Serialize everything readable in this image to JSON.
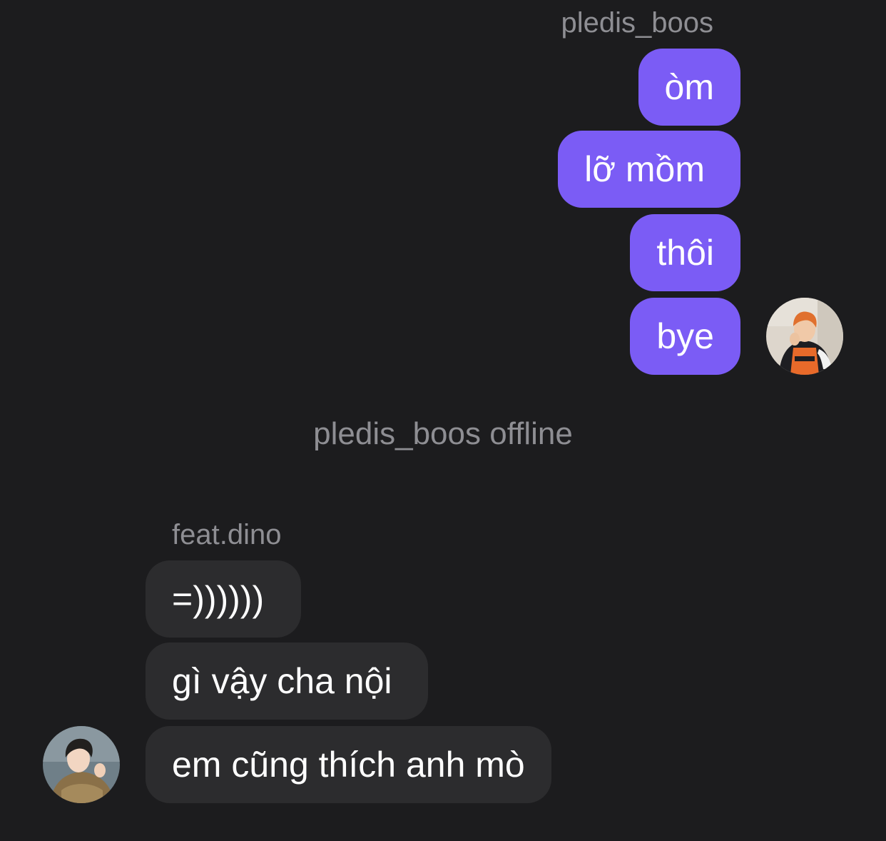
{
  "outgoing": {
    "sender": "pledis_boos",
    "messages": [
      "òm",
      "lỡ mồm",
      "thôi",
      "bye"
    ]
  },
  "status": "pledis_boos offline",
  "incoming": {
    "sender": "feat.dino",
    "messages": [
      "=))))))",
      "gì vậy cha nội",
      "em cũng thích anh mò"
    ]
  },
  "colors": {
    "background": "#1c1c1e",
    "outgoing_bubble": "#7b5cf5",
    "incoming_bubble": "#2c2c2e",
    "secondary_text": "#8e8e93"
  }
}
